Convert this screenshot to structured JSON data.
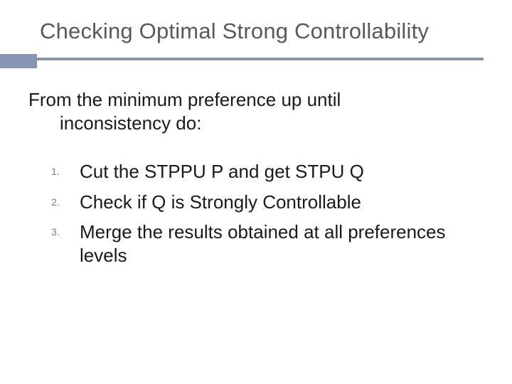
{
  "slide": {
    "title": "Checking Optimal Strong Controllability",
    "intro_line1": "From the minimum preference up until",
    "intro_line2": "inconsistency do:",
    "items": [
      {
        "marker": "1.",
        "text": "Cut the STPPU P and get STPU Q"
      },
      {
        "marker": "2.",
        "text": "Check if Q is Strongly Controllable"
      },
      {
        "marker": "3.",
        "text": "Merge the results obtained at all preferences levels"
      }
    ]
  }
}
